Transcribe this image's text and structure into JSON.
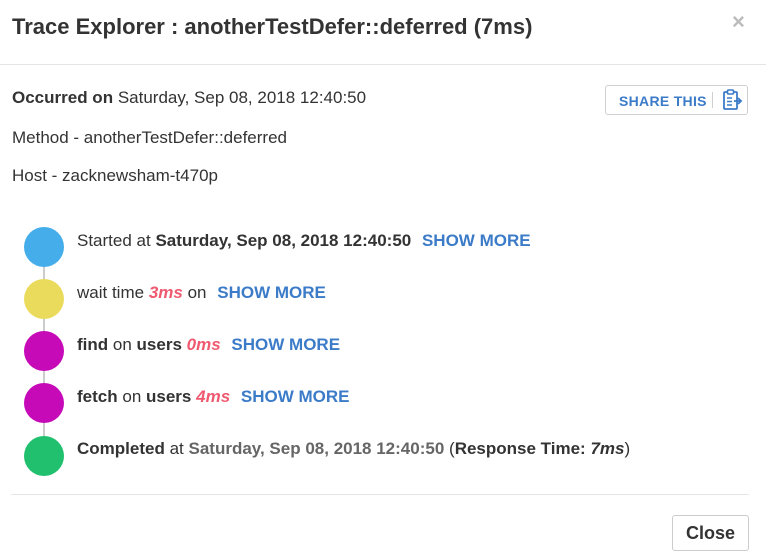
{
  "modal": {
    "title": "Trace Explorer : anotherTestDefer::deferred (7ms)",
    "close_glyph": "×"
  },
  "info": {
    "occurred_label": "Occurred on",
    "occurred_value": "Saturday, Sep 08, 2018 12:40:50",
    "method_text": "Method - anotherTestDefer::deferred",
    "host_text": "Host - zacknewsham-t470p"
  },
  "share": {
    "label": "SHARE THIS",
    "icon": "clipboard-icon"
  },
  "timeline": {
    "colors": {
      "started": "#45aeea",
      "wait": "#ebdb5c",
      "find": "#c60ab8",
      "fetch": "#c60ab8",
      "completed": "#21c06e"
    },
    "started": {
      "prefix": "Started at",
      "time": "Saturday, Sep 08, 2018 12:40:50",
      "link": "SHOW MORE"
    },
    "wait": {
      "prefix": "wait time",
      "ms": "3ms",
      "suffix": "on",
      "link": "SHOW MORE"
    },
    "find": {
      "op": "find",
      "on": "on",
      "collection": "users",
      "ms": "0ms",
      "link": "SHOW MORE"
    },
    "fetch": {
      "op": "fetch",
      "on": "on",
      "collection": "users",
      "ms": "4ms",
      "link": "SHOW MORE"
    },
    "completed": {
      "label": "Completed",
      "at": "at",
      "time": "Saturday, Sep 08, 2018 12:40:50",
      "open_paren": "(",
      "response_label": "Response Time:",
      "response_value": "7ms",
      "close_paren": ")"
    }
  },
  "footer": {
    "close_label": "Close"
  },
  "accent_color": "#3b7bc8",
  "ms_color": "#f05a70"
}
